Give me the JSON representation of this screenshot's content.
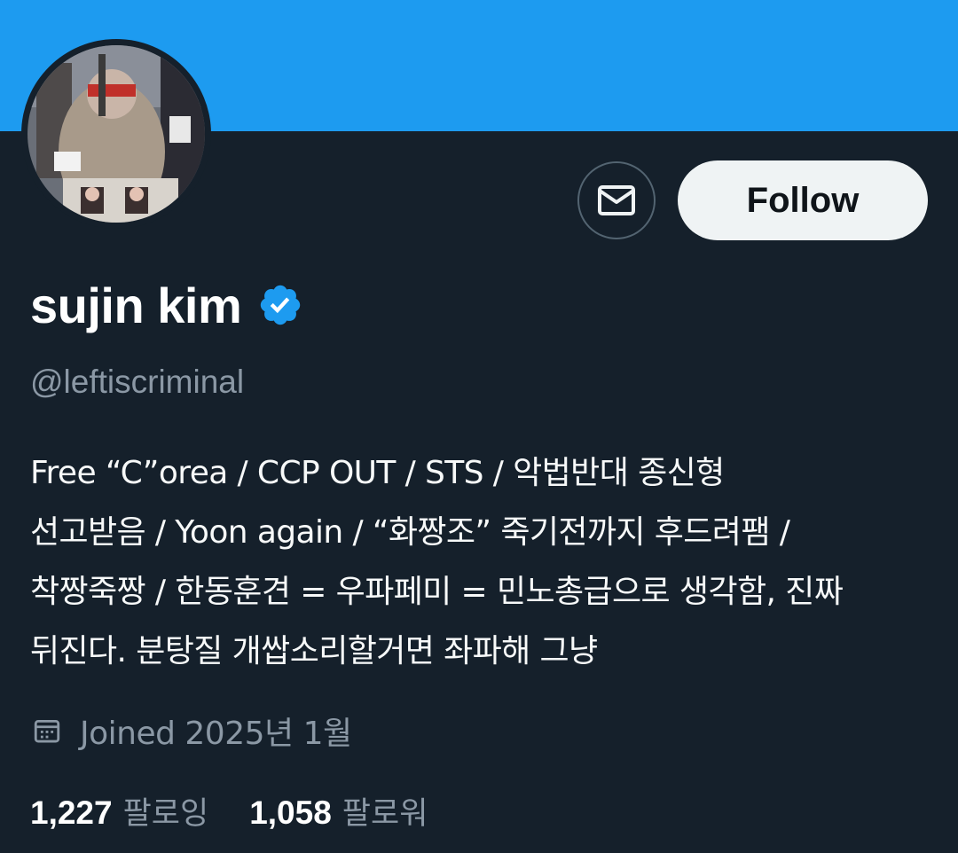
{
  "colors": {
    "banner": "#1d9bf0",
    "background": "#15202b",
    "muted_text": "#8b98a5",
    "verified_badge": "#1d9bf0"
  },
  "actions": {
    "message_icon": "envelope-icon",
    "follow_label": "Follow"
  },
  "profile": {
    "display_name": "sujin kim",
    "verified_icon": "verified-badge-icon",
    "handle": "@leftiscriminal",
    "bio_lines": [
      "Free “C”orea / CCP OUT / STS / 악법반대 종신형",
      "선고받음 / Yoon again / “화짱조” 죽기전까지 후드려팸 /",
      "착짱죽짱 / 한동훈견 = 우파페미 = 민노총급으로 생각함, 진짜",
      "뒤진다. 분탕질 개쌉소리할거면 좌파해 그냥"
    ],
    "joined_icon": "calendar-icon",
    "joined": "Joined 2025년 1월"
  },
  "stats": {
    "following_count": "1,227",
    "following_label": "팔로잉",
    "followers_count": "1,058",
    "followers_label": "팔로워"
  }
}
